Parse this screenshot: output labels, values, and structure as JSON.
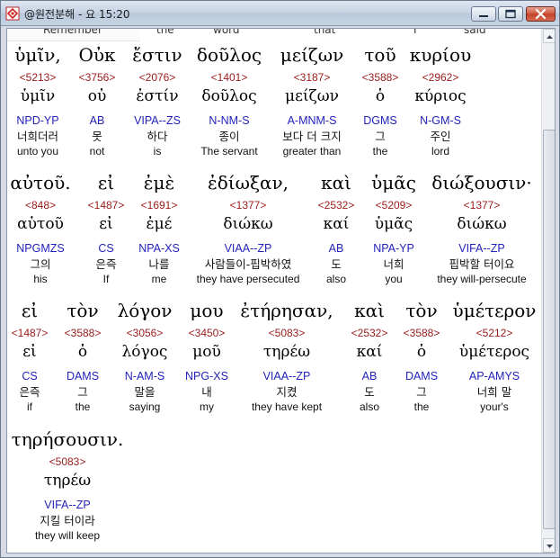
{
  "window": {
    "title": "@원전분해 - 요 15:20",
    "minimize_icon": "minimize-icon",
    "maximize_icon": "maximize-icon",
    "close_icon": "close-icon"
  },
  "partial_header": [
    "Remember",
    "the",
    "word",
    "that",
    "I",
    "said"
  ],
  "rows": [
    {
      "words": [
        {
          "greek": "ὑμῖν,",
          "strong": "<5213>",
          "lemma": "ὑμῖν",
          "parse": "NPD-YP",
          "korean": "너희더러",
          "english": "unto you"
        },
        {
          "greek": "Οὐκ",
          "strong": "<3756>",
          "lemma": "οὐ",
          "parse": "AB",
          "korean": "못",
          "english": "not"
        },
        {
          "greek": "ἔστιν",
          "strong": "<2076>",
          "lemma": "ἐστίν",
          "parse": "VIPA--ZS",
          "korean": "하다",
          "english": "is"
        },
        {
          "greek": "δοῦλος",
          "strong": "<1401>",
          "lemma": "δοῦλος",
          "parse": "N-NM-S",
          "korean": "종이",
          "english": "The servant"
        },
        {
          "greek": "μείζων",
          "strong": "<3187>",
          "lemma": "μείζων",
          "parse": "A-MNM-S",
          "korean": "보다 더 크지",
          "english": "greater than"
        },
        {
          "greek": "τοῦ",
          "strong": "<3588>",
          "lemma": "ὁ",
          "parse": "DGMS",
          "korean": "그",
          "english": "the"
        },
        {
          "greek": "κυρίου",
          "strong": "<2962>",
          "lemma": "κύριος",
          "parse": "N-GM-S",
          "korean": "주인",
          "english": "lord"
        }
      ]
    },
    {
      "words": [
        {
          "greek": "αὐτοῦ.",
          "strong": "<848>",
          "lemma": "αὑτοῦ",
          "parse": "NPGMZS",
          "korean": "그의",
          "english": "his"
        },
        {
          "greek": "εἰ",
          "strong": "<1487>",
          "lemma": "εἰ",
          "parse": "CS",
          "korean": "은즉",
          "english": "If"
        },
        {
          "greek": "ἐμὲ",
          "strong": "<1691>",
          "lemma": "ἐμέ",
          "parse": "NPA-XS",
          "korean": "나를",
          "english": "me"
        },
        {
          "greek": "ἐδίωξαν,",
          "strong": "<1377>",
          "lemma": "διώκω",
          "parse": "VIAA--ZP",
          "korean": "사람들이-핍박하였",
          "english": "they have persecuted"
        },
        {
          "greek": "καὶ",
          "strong": "<2532>",
          "lemma": "καί",
          "parse": "AB",
          "korean": "도",
          "english": "also"
        },
        {
          "greek": "ὑμᾶς",
          "strong": "<5209>",
          "lemma": "ὑμᾶς",
          "parse": "NPA-YP",
          "korean": "너희",
          "english": "you"
        },
        {
          "greek": "διώξουσιν·",
          "strong": "<1377>",
          "lemma": "διώκω",
          "parse": "VIFA--ZP",
          "korean": "핍박할 터이요",
          "english": "they will-persecute"
        }
      ]
    },
    {
      "words": [
        {
          "greek": "εἰ",
          "strong": "<1487>",
          "lemma": "εἰ",
          "parse": "CS",
          "korean": "은즉",
          "english": "if"
        },
        {
          "greek": "τὸν",
          "strong": "<3588>",
          "lemma": "ὁ",
          "parse": "DAMS",
          "korean": "그",
          "english": "the"
        },
        {
          "greek": "λόγον",
          "strong": "<3056>",
          "lemma": "λόγος",
          "parse": "N-AM-S",
          "korean": "말을",
          "english": "saying"
        },
        {
          "greek": "μου",
          "strong": "<3450>",
          "lemma": "μοῦ",
          "parse": "NPG-XS",
          "korean": "내",
          "english": "my"
        },
        {
          "greek": "ἐτήρησαν,",
          "strong": "<5083>",
          "lemma": "τηρέω",
          "parse": "VIAA--ZP",
          "korean": "지켰",
          "english": "they have kept"
        },
        {
          "greek": "καὶ",
          "strong": "<2532>",
          "lemma": "καί",
          "parse": "AB",
          "korean": "도",
          "english": "also"
        },
        {
          "greek": "τὸν",
          "strong": "<3588>",
          "lemma": "ὁ",
          "parse": "DAMS",
          "korean": "그",
          "english": "the"
        },
        {
          "greek": "ὑμέτερον",
          "strong": "<5212>",
          "lemma": "ὑμέτερος",
          "parse": "AP-AMYS",
          "korean": "너희 말",
          "english": "your's"
        }
      ]
    },
    {
      "words": [
        {
          "greek": "τηρήσουσιν.",
          "strong": "<5083>",
          "lemma": "τηρέω",
          "parse": "VIFA--ZP",
          "korean": "지킬 터이라",
          "english": "they will keep"
        }
      ]
    }
  ],
  "colors": {
    "strong_number": "#9a1b1b",
    "parsing_code": "#2323b8",
    "text": "#111111"
  }
}
